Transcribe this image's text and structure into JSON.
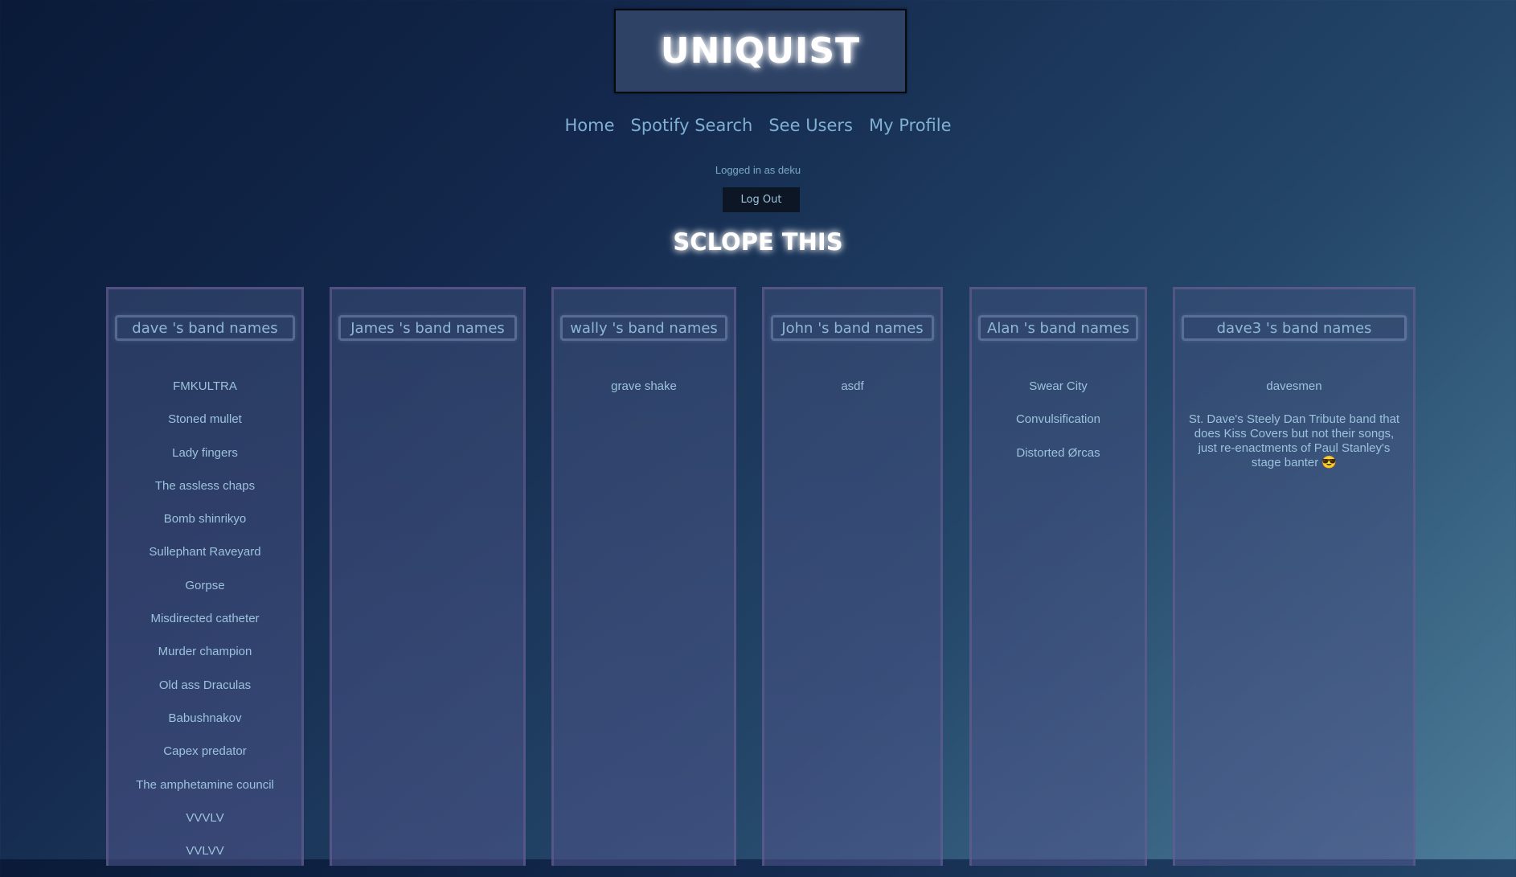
{
  "header": {
    "title": "UNIQUIST"
  },
  "nav": {
    "items": [
      {
        "label": "Home"
      },
      {
        "label": "Spotify Search"
      },
      {
        "label": "See Users"
      },
      {
        "label": "My Profile"
      }
    ]
  },
  "session": {
    "logged_in_text": "Logged in as deku",
    "logout_label": "Log Out"
  },
  "main": {
    "section_title": "SCLOPE THIS",
    "users": [
      {
        "heading": "dave 's band names",
        "bands": [
          "FMKULTRA",
          "Stoned mullet",
          "Lady fingers",
          "The assless chaps",
          "Bomb shinrikyo",
          "Sullephant Raveyard",
          "Gorpse",
          "Misdirected catheter",
          "Murder champion",
          "Old ass Draculas",
          "Babushnakov",
          "Capex predator",
          "The amphetamine council",
          "VVVLV",
          "VVLVV"
        ]
      },
      {
        "heading": "James 's band names",
        "bands": []
      },
      {
        "heading": "wally 's band names",
        "bands": [
          "grave shake"
        ]
      },
      {
        "heading": "John 's band names",
        "bands": [
          "asdf"
        ]
      },
      {
        "heading": "Alan 's band names",
        "bands": [
          "Swear City",
          "Convulsification",
          "Distorted Ørcas"
        ]
      },
      {
        "heading": "dave3 's band names",
        "bands": [
          "davesmen",
          "St. Dave's Steely Dan Tribute band that does Kiss Covers but not their songs, just re-enactments of Paul Stanley's stage banter 😎"
        ]
      }
    ]
  }
}
